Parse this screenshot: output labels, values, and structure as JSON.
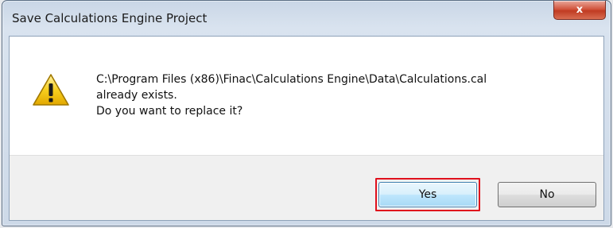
{
  "window": {
    "title": "Save Calculations Engine Project",
    "close_label": "x"
  },
  "dialog": {
    "icon": "warning-icon",
    "message_lines": [
      "C:\\Program Files (x86)\\Finac\\Calculations Engine\\Data\\Calculations.cal",
      "already exists.",
      "Do you want to replace it?"
    ]
  },
  "buttons": {
    "yes_label": "Yes",
    "no_label": "No"
  },
  "colors": {
    "highlight": "#e0101c",
    "warning_fill": "#f5c400",
    "close_button": "#c9442b"
  }
}
